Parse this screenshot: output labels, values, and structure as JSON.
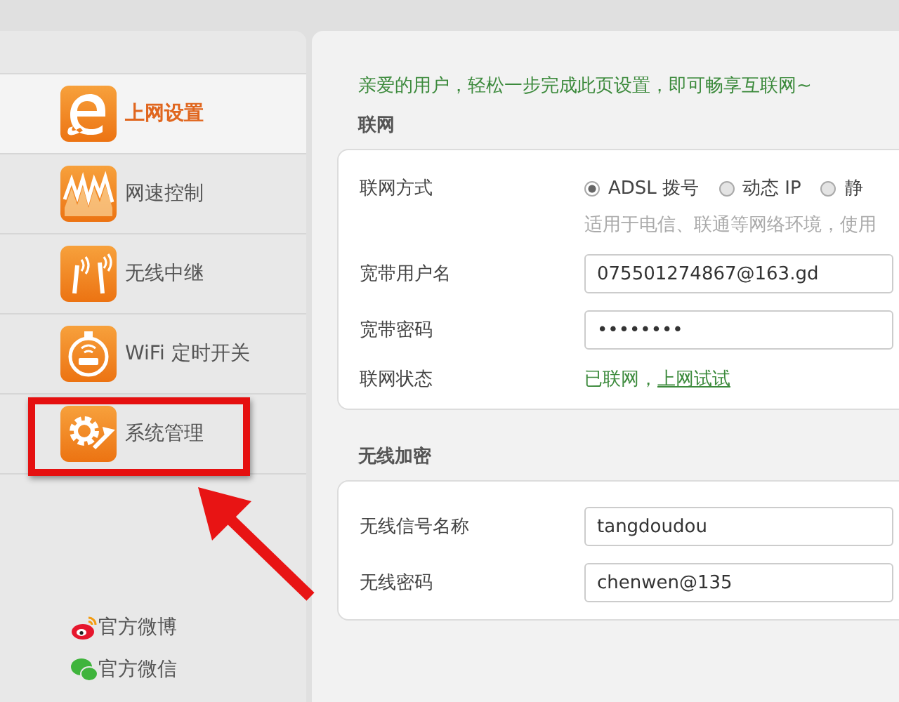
{
  "sidebar": {
    "items": [
      {
        "label": "上网设置",
        "selected": true,
        "highlighted": false
      },
      {
        "label": "网速控制",
        "selected": false,
        "highlighted": false
      },
      {
        "label": "无线中继",
        "selected": false,
        "highlighted": false
      },
      {
        "label": "WiFi 定时开关",
        "selected": false,
        "highlighted": false
      },
      {
        "label": "系统管理",
        "selected": false,
        "highlighted": true
      }
    ],
    "links": [
      {
        "label": "官方微博"
      },
      {
        "label": "官方微信"
      }
    ]
  },
  "content": {
    "intro": "亲爱的用户，轻松一步完成此页设置，即可畅享互联网~",
    "sections": [
      {
        "title": "联网",
        "rows": [
          {
            "kind": "radio",
            "label": "联网方式",
            "options": [
              {
                "label": "ADSL 拨号",
                "selected": true
              },
              {
                "label": "动态 IP",
                "selected": false
              },
              {
                "label": "静",
                "selected": false
              }
            ],
            "hint": "适用于电信、联通等网络环境，使用"
          },
          {
            "kind": "input",
            "label": "宽带用户名",
            "value": "075501274867@163.gd"
          },
          {
            "kind": "input",
            "label": "宽带密码",
            "value": "••••••••"
          },
          {
            "kind": "status",
            "label": "联网状态",
            "status": "已联网，",
            "link": "上网试试"
          }
        ]
      },
      {
        "title": "无线加密",
        "rows": [
          {
            "kind": "input",
            "label": "无线信号名称",
            "value": "tangdoudou"
          },
          {
            "kind": "input",
            "label": "无线密码",
            "value": "chenwen@135"
          }
        ]
      }
    ]
  }
}
